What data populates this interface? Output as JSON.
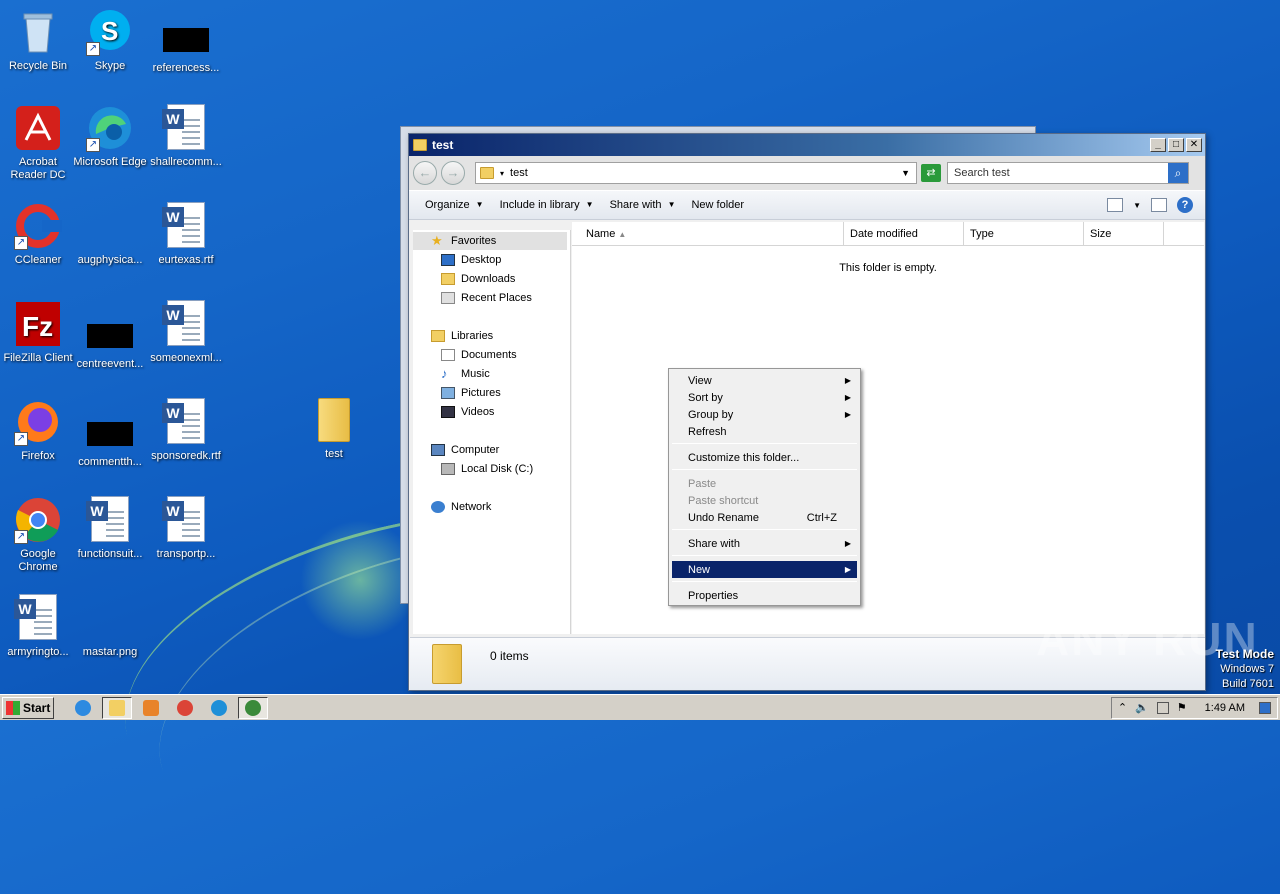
{
  "desktop": {
    "icons": [
      {
        "label": "Recycle Bin"
      },
      {
        "label": "Skype"
      },
      {
        "label": "referencess..."
      },
      {
        "label": "Acrobat Reader DC"
      },
      {
        "label": "Microsoft Edge"
      },
      {
        "label": "shallrecomm..."
      },
      {
        "label": "CCleaner"
      },
      {
        "label": "augphysica..."
      },
      {
        "label": "eurtexas.rtf"
      },
      {
        "label": "FileZilla Client"
      },
      {
        "label": "centreevent..."
      },
      {
        "label": "someonexml..."
      },
      {
        "label": "Firefox"
      },
      {
        "label": "commentth..."
      },
      {
        "label": "sponsoredk.rtf"
      },
      {
        "label": "Google Chrome"
      },
      {
        "label": "functionsuit..."
      },
      {
        "label": "transportp..."
      },
      {
        "label": "armyringto..."
      },
      {
        "label": "mastar.png"
      }
    ],
    "folder_label": "test"
  },
  "window": {
    "title": "test",
    "address": "test",
    "search_placeholder": "Search test",
    "min_btn": "_",
    "max_btn": "□",
    "close_btn": "✕",
    "commands": {
      "organize": "Organize",
      "include": "Include in library",
      "share": "Share with",
      "new_folder": "New folder"
    },
    "nav": {
      "favorites": "Favorites",
      "desktop": "Desktop",
      "downloads": "Downloads",
      "recent": "Recent Places",
      "libraries": "Libraries",
      "documents": "Documents",
      "music": "Music",
      "pictures": "Pictures",
      "videos": "Videos",
      "computer": "Computer",
      "local_disk": "Local Disk (C:)",
      "network": "Network"
    },
    "columns": [
      "Name",
      "Date modified",
      "Type",
      "Size"
    ],
    "empty_text": "This folder is empty.",
    "item_count": "0 items"
  },
  "context_menu": {
    "view": "View",
    "sort_by": "Sort by",
    "group_by": "Group by",
    "refresh": "Refresh",
    "customize": "Customize this folder...",
    "paste": "Paste",
    "paste_shortcut": "Paste shortcut",
    "undo_rename": "Undo Rename",
    "undo_shortcut": "Ctrl+Z",
    "share_with": "Share with",
    "new": "New",
    "properties": "Properties"
  },
  "overlay": {
    "watermark": "ANY RUN",
    "test_mode": "Test Mode",
    "os": "Windows 7",
    "build": "Build 7601"
  },
  "taskbar": {
    "start": "Start",
    "clock": "1:49 AM"
  },
  "colors": {
    "desktop_bg": "#1566c8",
    "titlebar": "#0a246a",
    "menu_highlight": "#0a246a"
  }
}
